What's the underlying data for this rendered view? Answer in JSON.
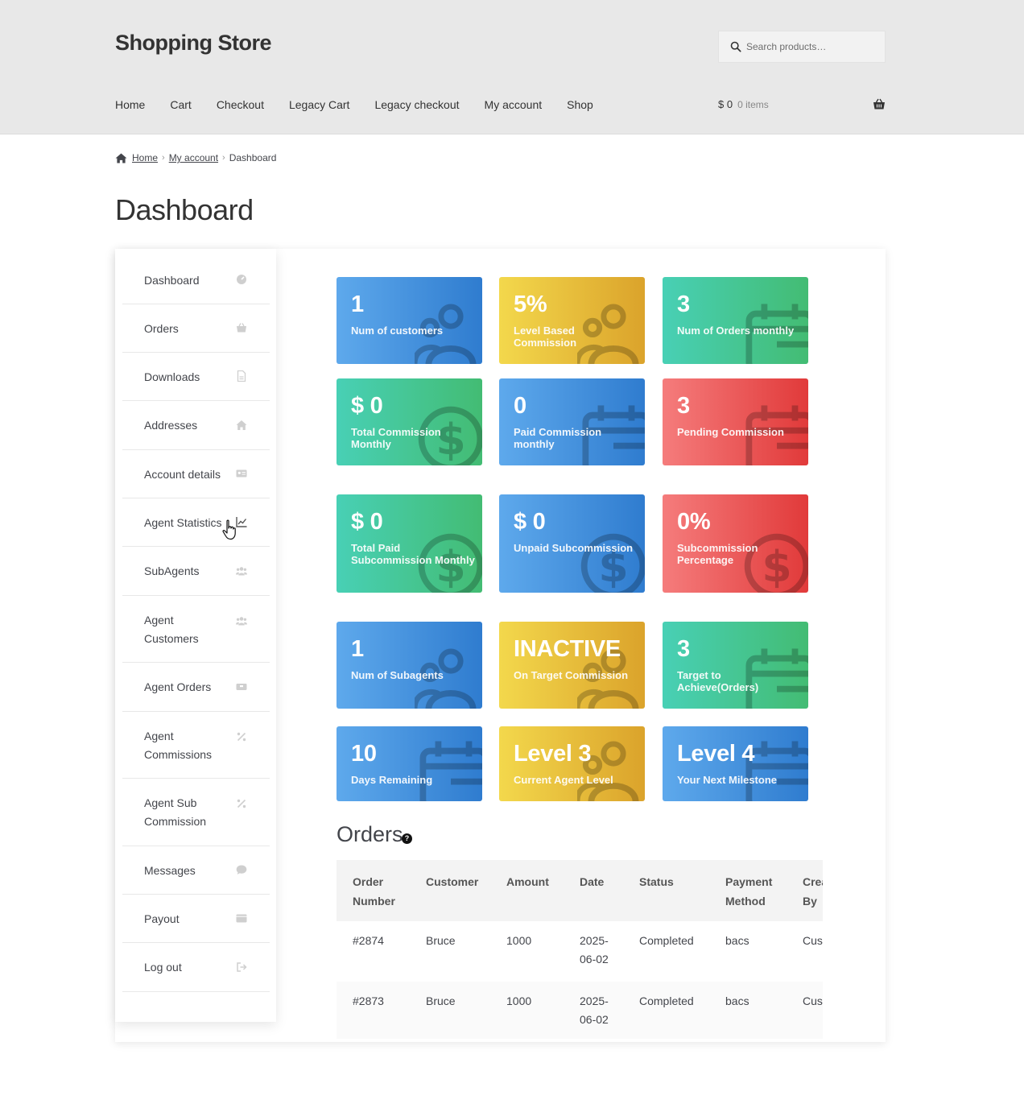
{
  "header": {
    "site_title": "Shopping Store",
    "search_placeholder": "Search products…",
    "nav": [
      "Home",
      "Cart",
      "Checkout",
      "Legacy Cart",
      "Legacy checkout",
      "My account",
      "Shop"
    ],
    "cart_amount": "$ 0",
    "cart_items": "0 items"
  },
  "breadcrumb": {
    "home": "Home",
    "my_account": "My account",
    "current": "Dashboard"
  },
  "page_title": "Dashboard",
  "sidebar": {
    "items": [
      {
        "label": "Dashboard",
        "icon": "dashboard-icon"
      },
      {
        "label": "Orders",
        "icon": "basket-icon"
      },
      {
        "label": "Downloads",
        "icon": "file-icon"
      },
      {
        "label": "Addresses",
        "icon": "home-icon"
      },
      {
        "label": "Account details",
        "icon": "id-card-icon"
      },
      {
        "label": "Agent Statistics",
        "icon": "chart-line-icon"
      },
      {
        "label": "SubAgents",
        "icon": "users-icon"
      },
      {
        "label": "Agent\nCustomers",
        "icon": "users-icon"
      },
      {
        "label": "Agent Orders",
        "icon": "boxes-icon"
      },
      {
        "label": "Agent\nCommissions",
        "icon": "percent-icon"
      },
      {
        "label": "Agent Sub\nCommission",
        "icon": "percent-icon"
      },
      {
        "label": "Messages",
        "icon": "chat-icon"
      },
      {
        "label": "Payout",
        "icon": "wallet-icon"
      },
      {
        "label": "Log out",
        "icon": "logout-icon"
      }
    ]
  },
  "cards": [
    {
      "value": "1",
      "label": "Num of customers",
      "color": "blue",
      "icon": "users"
    },
    {
      "value": "5%",
      "label": "Level Based Commission",
      "color": "yellow",
      "icon": "users"
    },
    {
      "value": "3",
      "label": "Num of Orders monthly",
      "color": "green",
      "icon": "calendar"
    },
    {
      "value": "$ 0",
      "label": "Total Commission Monthly",
      "color": "green",
      "icon": "dollar"
    },
    {
      "value": "0",
      "label": "Paid Commission monthly",
      "color": "blue",
      "icon": "calendar"
    },
    {
      "value": "3",
      "label": "Pending Commission",
      "color": "red",
      "icon": "calendar"
    },
    {
      "value": "$ 0",
      "label": "Total Paid Subcommission Monthly",
      "color": "green",
      "icon": "dollar"
    },
    {
      "value": "$ 0",
      "label": "Unpaid Subcommission",
      "color": "blue",
      "icon": "dollar"
    },
    {
      "value": "0%",
      "label": "Subcommission Percentage",
      "color": "red",
      "icon": "dollar"
    },
    {
      "value": "1",
      "label": "Num of Subagents",
      "color": "blue",
      "icon": "users"
    },
    {
      "value": "INACTIVE",
      "label": "On Target Commission",
      "color": "yellow",
      "icon": "users"
    },
    {
      "value": "3",
      "label": "Target to Achieve(Orders)",
      "color": "green",
      "icon": "calendar"
    },
    {
      "value": "10",
      "label": "Days Remaining",
      "color": "blue",
      "icon": "calendar"
    },
    {
      "value": "Level 3",
      "label": "Current Agent Level",
      "color": "yellow",
      "icon": "users"
    },
    {
      "value": "Level 4",
      "label": "Your Next Milestone",
      "color": "blue",
      "icon": "calendar"
    }
  ],
  "orders": {
    "title": "Orders",
    "help": "?",
    "columns": [
      "Order\nNumber",
      "Customer",
      "Amount",
      "Date",
      "Status",
      "Payment\nMethod",
      "Created\nBy"
    ],
    "rows": [
      [
        "#2874",
        "Bruce",
        "1000",
        "2025-\n06-02",
        "Completed",
        "bacs",
        "Customer"
      ],
      [
        "#2873",
        "Bruce",
        "1000",
        "2025-\n06-02",
        "Completed",
        "bacs",
        "Customer"
      ]
    ]
  }
}
